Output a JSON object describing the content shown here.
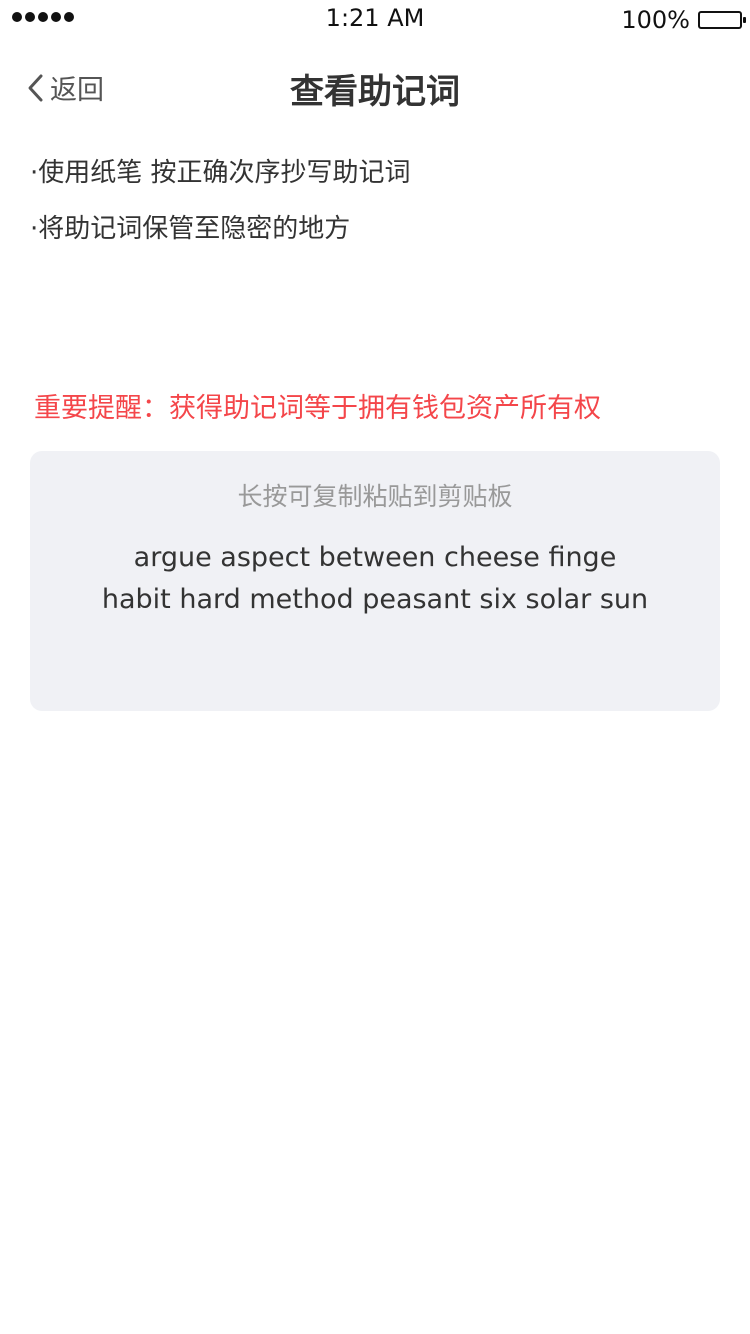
{
  "status_bar": {
    "time": "1:21 AM",
    "battery_text": "100%",
    "battery_level_percent": 100,
    "signal_dots": 5
  },
  "nav": {
    "back_label": "返回",
    "title": "查看助记词"
  },
  "tips": [
    "·使用纸笔 按正确次序抄写助记词",
    "·将助记词保管至隐密的地方"
  ],
  "warning": "重要提醒：获得助记词等于拥有钱包资产所有权",
  "mnemonic_card": {
    "hint": "长按可复制粘贴到剪贴板",
    "words_line_1": "argue aspect between cheese finge",
    "words_line_2": "habit hard method peasant six solar sun"
  },
  "colors": {
    "warning": "#f4464a",
    "card_background": "#f0f1f5",
    "hint_text": "#999999",
    "primary_text": "#333333"
  },
  "icons": {
    "back": "chevron-left-icon",
    "battery": "battery-icon",
    "signal": "signal-dots-icon"
  }
}
